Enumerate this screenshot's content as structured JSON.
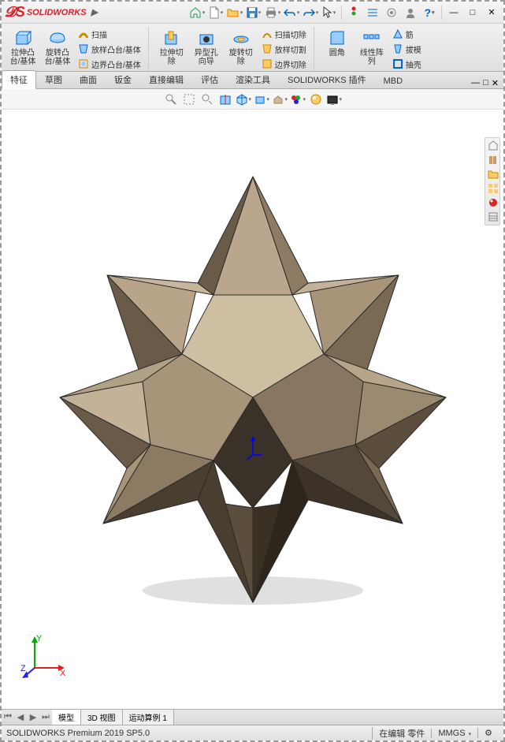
{
  "app": {
    "name": "SOLIDWORKS"
  },
  "titlebar_icons": [
    "home",
    "file",
    "open",
    "save",
    "print",
    "options",
    "undo",
    "redo",
    "cursor",
    "rebuild",
    "settings",
    "measure",
    "user",
    "help"
  ],
  "ribbon": {
    "g1": {
      "extrude": "拉伸凸台/基体",
      "revolve": "旋转凸台/基体",
      "sweep": "扫描",
      "loft": "放样凸台/基体",
      "boundary": "边界凸台/基体"
    },
    "g2": {
      "cut_extrude": "拉伸切除",
      "hole": "异型孔向导",
      "cut_revolve": "旋转切除",
      "cut_sweep": "扫描切除",
      "cut_loft": "放样切割",
      "cut_boundary": "边界切除"
    },
    "g3": {
      "fillet": "圆角",
      "pattern": "线性阵列",
      "rib": "筋",
      "draft": "拔模",
      "shell": "抽壳"
    }
  },
  "tabs": [
    "特征",
    "草图",
    "曲面",
    "钣金",
    "直接编辑",
    "评估",
    "渲染工具",
    "SOLIDWORKS 插件",
    "MBD"
  ],
  "active_tab": 0,
  "bottom_tabs": [
    "模型",
    "3D 视图",
    "运动算例 1"
  ],
  "active_bottom_tab": 0,
  "status": {
    "version": "SOLIDWORKS Premium 2019 SP5.0",
    "edit_state": "在编辑 零件",
    "units": "MMGS"
  }
}
